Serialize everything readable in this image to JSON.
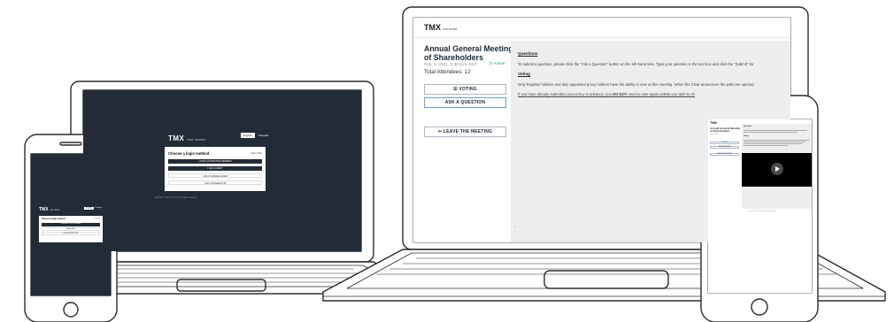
{
  "middle_laptop": {
    "logo": "TMX",
    "logo_sub": "TSX TRUST",
    "lang_english": "English",
    "lang_french": "Français",
    "card_title": "Choose a login method",
    "card_secondary": "SECURE",
    "buttons": [
      "LOGIN AS POSITION MEMBER",
      "I AM A GUEST",
      "I AM A SHAREHOLDER",
      "I AM A MODERATOR"
    ],
    "copyright": "Copyright © 2021 TSX Trust. All rights reserved."
  },
  "small_phone": {
    "logo": "TMX",
    "logo_sub": "TSX TRUST",
    "lang_english": "English",
    "lang_french": "Français",
    "card_title": "Choose a login method",
    "card_secondary": "Secure",
    "buttons": [
      "LOGIN AS POSITION MEMBER",
      "I AM A GUEST",
      "I AM A SHAREHOLDER"
    ]
  },
  "right_laptop": {
    "logo": "TMX",
    "logo_sub": "TSX TRUST",
    "meeting_title": "Annual General Meeting of Shareholders",
    "date": "Feb. 4, 2021, 2:30 p.m. EST",
    "status": "Active",
    "attendees": "Total Attendees: 12",
    "buttons": {
      "voting": "VOTING",
      "ask_question": "ASK A QUESTION",
      "leave": "LEAVE THE MEETING"
    },
    "content": {
      "questions_heading": "Questions",
      "questions_text": "To submit a question, please click the \"Ask a Question\" button on the left-hand side. Type your question in the text box and click the \"Submit\" bu",
      "voting_heading": "Voting",
      "voting_text": "Only Register holders and duly appointed proxy holders have the ability to vote at this meeting. When the Chair announces the polls are opened",
      "proxy_text_a": "If you have already submitted your proxy in advance, you ",
      "proxy_text_b": "DO NOT",
      "proxy_text_c": " need to vote again unless you wish to ch"
    }
  },
  "right_phone": {
    "logo": "TMX",
    "meeting_title": "Annual General Meeting of Shareholders",
    "date": "Feb. 4, 2021",
    "status": "Active",
    "voting": "VOTING",
    "ask_question": "ASK A QUESTION",
    "leave": "LEAVE THE MEETING",
    "questions_heading": "Questions",
    "voting_heading": "Voting",
    "copyright": "Copyright © 2021 TSX Trust. All rights reserved."
  },
  "colors": {
    "dark_screen": "#232b36",
    "active_green": "#2aa36a",
    "accent_blue": "#6aa0d0"
  }
}
